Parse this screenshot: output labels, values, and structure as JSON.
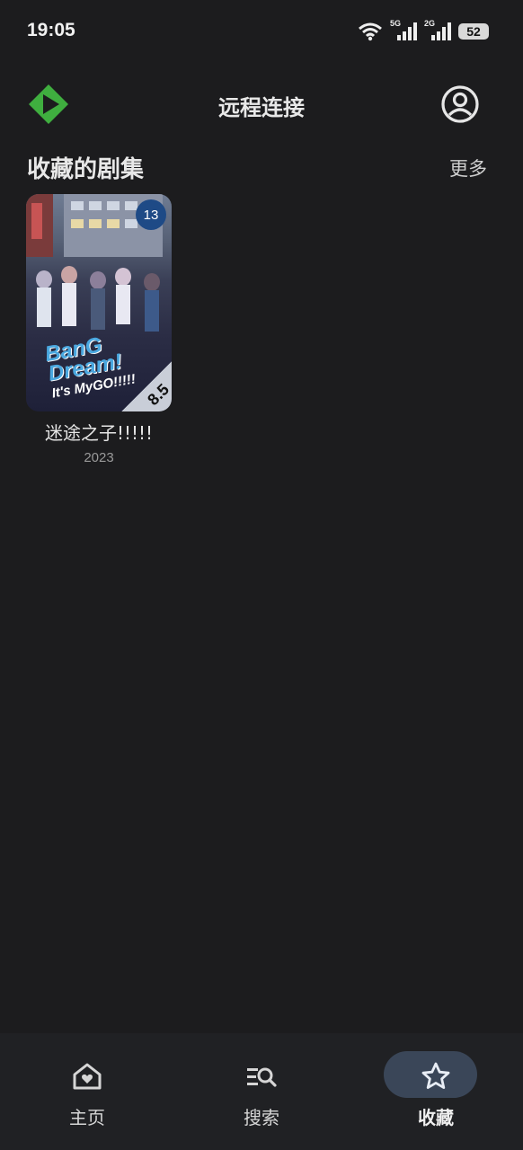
{
  "status_bar": {
    "time": "19:05",
    "sim1_tag": "5G",
    "sim2_tag": "2G",
    "battery": "52"
  },
  "app_bar": {
    "title": "远程连接"
  },
  "favorites": {
    "section_title": "收藏的剧集",
    "more_label": "更多",
    "items": [
      {
        "title": "迷途之子!!!!!",
        "year": "2023",
        "episodes": "13",
        "rating": "8.5",
        "poster_logo": "BanG Dream!",
        "poster_sub": "It's MyGO!!!!!"
      }
    ]
  },
  "bottom_nav": {
    "items": [
      {
        "label": "主页",
        "icon": "home-heart-icon"
      },
      {
        "label": "搜索",
        "icon": "search-list-icon"
      },
      {
        "label": "收藏",
        "icon": "star-icon",
        "active": true
      }
    ]
  },
  "colors": {
    "background": "#1c1c1e",
    "logo_green": "#3fae3f",
    "nav_active_pill": "#3a4658",
    "badge_blue": "#1e4a86"
  }
}
